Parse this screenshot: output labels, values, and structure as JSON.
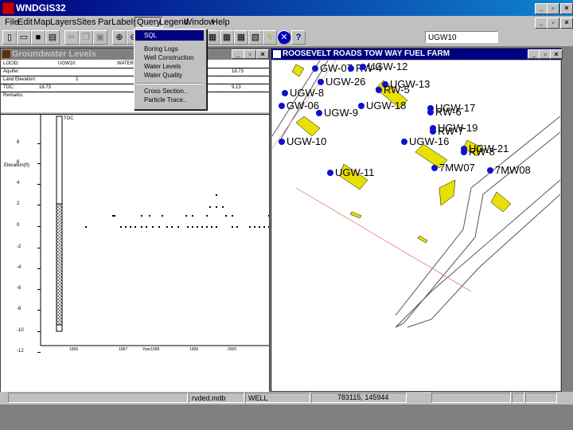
{
  "app": {
    "title": "WNDGIS32"
  },
  "menu": [
    "File",
    "Edit",
    "Map",
    "Layers",
    "Sites",
    "ParLabels",
    "Query",
    "Legend",
    "Window",
    "Help"
  ],
  "toolbar": {
    "combo_value": "UGW10"
  },
  "query_menu": {
    "items": [
      "SQL",
      "Boring Logs",
      "Well Construction",
      "Water Levels",
      "Water Quality",
      "Cross Section..",
      "Particle Trace.."
    ]
  },
  "gw_window": {
    "title": "Groundwater Levels",
    "info": {
      "locid_label": "LOCID:",
      "locid_value": "UGW10",
      "wl_label": "WATER LE",
      "aquifer_label": "Aquifer:",
      "aquifer_value": "18.73",
      "elev_label": "Land Elevation:",
      "elev_value": "2",
      "toc_label": "TOC:",
      "toc_value": "18.73",
      "toc_value2": "9.13",
      "remarks_label": "Remarks:"
    },
    "plot": {
      "ylabel": "Elevation(ft)",
      "toc_label": "TOC",
      "yticks": [
        "8",
        "6",
        "4",
        "2",
        "0",
        "-2",
        "-4",
        "-6",
        "-8",
        "-10",
        "-12"
      ],
      "xticks": [
        "1996",
        "1997",
        "Year1998",
        "1999",
        "2000"
      ]
    }
  },
  "map_window": {
    "title": "ROOSEVELT ROADS TOW WAY FUEL FARM",
    "wells": [
      "GW-07",
      "RW-4",
      "UGW-12",
      "UGW-26",
      "UGW-13",
      "RW-5",
      "UGW-8",
      "GW-06",
      "UGW-9",
      "UGW-18",
      "UGW-17",
      "RW-6",
      "UGW-19",
      "RW-7",
      "UGW-10",
      "UGW-16",
      "UGW-21",
      "RW-8",
      "UGW-11",
      "7MW07",
      "7MW08"
    ]
  },
  "status": {
    "db": "rvded.mdb",
    "layer": "WELL",
    "coords": "783115, 145944"
  }
}
